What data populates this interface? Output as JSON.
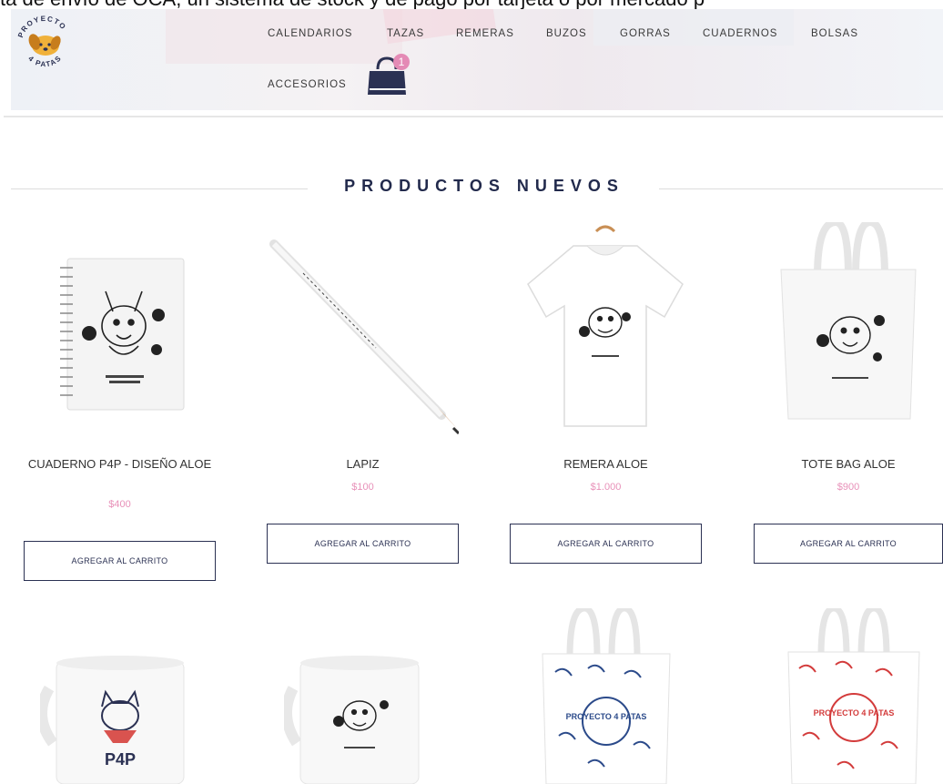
{
  "banner_text": "ta de envío de OCA, un sistema de stock y de pago por tarjeta o por mercado p",
  "logo": {
    "text_top": "PROYECTO",
    "text_bottom": "4 PATAS"
  },
  "nav": {
    "items": [
      "CALENDARIOS",
      "TAZAS",
      "REMERAS",
      "BUZOS",
      "GORRAS",
      "CUADERNOS",
      "BOLSAS",
      "ACCESORIOS"
    ]
  },
  "cart": {
    "count": "1",
    "icon": "shopping-bag-icon"
  },
  "section": {
    "title": "PRODUCTOS NUEVOS"
  },
  "products": [
    {
      "name": "CUADERNO P4P - DISEÑO ALOE",
      "price": "$400",
      "button": "AGREGAR AL CARRITO"
    },
    {
      "name": "LAPIZ",
      "price": "$100",
      "button": "AGREGAR AL CARRITO"
    },
    {
      "name": "REMERA ALOE",
      "price": "$1.000",
      "button": "AGREGAR AL CARRITO"
    },
    {
      "name": "TOTE BAG ALOE",
      "price": "$900",
      "button": "AGREGAR AL CARRITO"
    }
  ],
  "row2_images": [
    "mug-cat-p4p",
    "mug-aloe",
    "tote-bag-blue-dogs",
    "tote-bag-red-dogs"
  ],
  "row2_texts": {
    "mug1_logo": "P4P",
    "bag1_text": "PROYECTO 4 PATAS",
    "bag2_text": "PROYECTO 4 PATAS"
  },
  "colors": {
    "navy": "#2b3153",
    "pink": "#e891b9",
    "badge": "#e48ab5"
  }
}
